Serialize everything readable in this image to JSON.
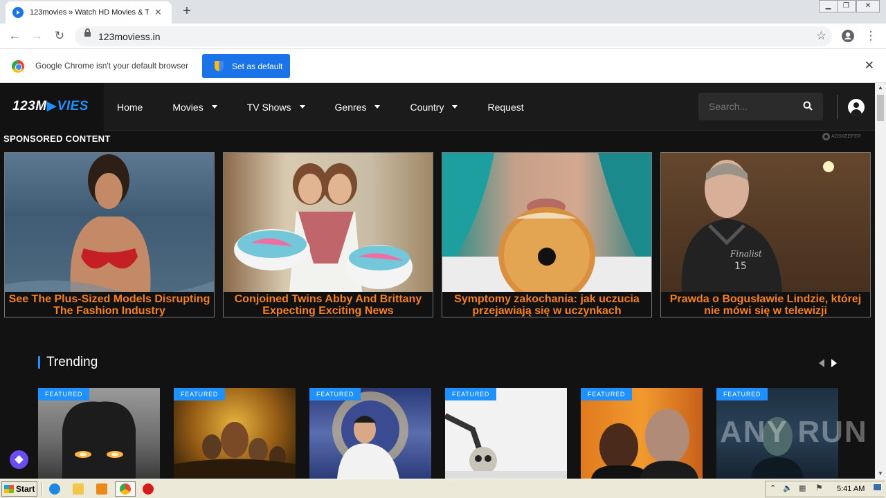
{
  "browser": {
    "tab_title": "123movies » Watch HD Movies & TV",
    "url": "123moviess.in",
    "infobar_text": "Google Chrome isn't your default browser",
    "set_default_label": "Set as default"
  },
  "site": {
    "logo_part1": "123M",
    "logo_part2": "VIES",
    "nav": [
      {
        "label": "Home",
        "has_dropdown": false
      },
      {
        "label": "Movies",
        "has_dropdown": true
      },
      {
        "label": "TV Shows",
        "has_dropdown": true
      },
      {
        "label": "Genres",
        "has_dropdown": true
      },
      {
        "label": "Country",
        "has_dropdown": true
      },
      {
        "label": "Request",
        "has_dropdown": false
      }
    ],
    "search_placeholder": "Search..."
  },
  "sponsored": {
    "heading": "SPONSORED CONTENT",
    "network": "ADSKEEPER",
    "ads": [
      {
        "caption": "See The Plus-Sized Models Disrupting The Fashion Industry"
      },
      {
        "caption": "Conjoined Twins Abby And Brittany Expecting Exciting News"
      },
      {
        "caption": "Symptomy zakochania: jak uczucia przejawiają się w uczynkach"
      },
      {
        "caption": "Prawda o Bogusławie Lindzie, której nie mówi się w telewizji"
      }
    ]
  },
  "trending": {
    "title": "Trending",
    "badge": "FEATURED",
    "count": 6
  },
  "watermark": "ANY RUN",
  "taskbar": {
    "start_label": "Start",
    "clock": "5:41 AM"
  },
  "colors": {
    "accent": "#1e90ff",
    "ad_caption": "#f5801f",
    "page_bg": "#121212"
  }
}
